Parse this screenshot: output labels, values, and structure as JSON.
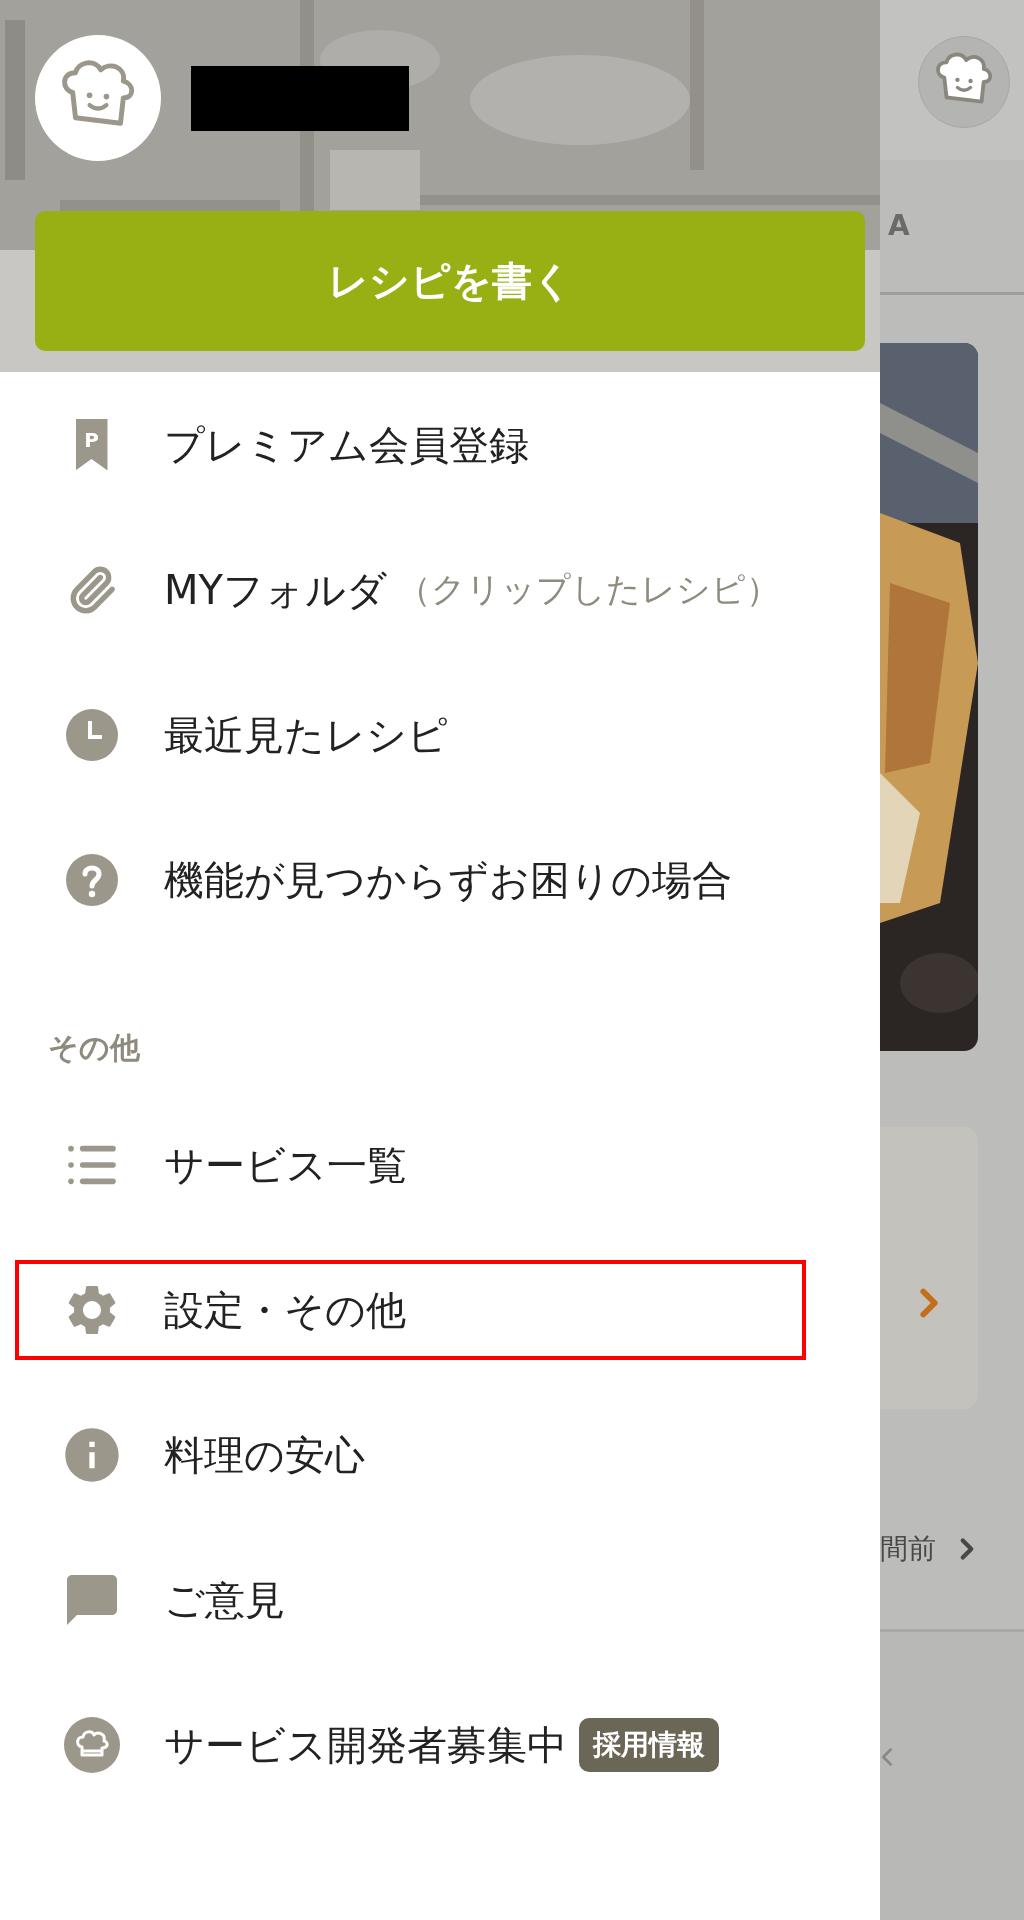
{
  "header": {
    "write_button": "レシピを書く"
  },
  "menu": [
    {
      "kind": "premium",
      "icon_text": "P",
      "label": "プレミアム会員登録"
    },
    {
      "kind": "folder",
      "label": "MYフォルダ",
      "note": "（クリップしたレシピ）"
    },
    {
      "kind": "history",
      "label": "最近見たレシピ"
    },
    {
      "kind": "help",
      "label": "機能が見つからずお困りの場合"
    }
  ],
  "section_label": "その他",
  "other_menu": [
    {
      "kind": "list",
      "label": "サービス一覧",
      "highlighted": false
    },
    {
      "kind": "settings",
      "label": "設定・その他",
      "highlighted": true
    },
    {
      "kind": "info",
      "label": "料理の安心",
      "highlighted": false
    },
    {
      "kind": "feedback",
      "label": "ご意見",
      "highlighted": false
    },
    {
      "kind": "chef",
      "label": "サービス開発者募集中",
      "badge": "採用情報",
      "highlighted": false
    }
  ],
  "background": {
    "tab_fragment": "A",
    "time_fragment": "間前"
  }
}
